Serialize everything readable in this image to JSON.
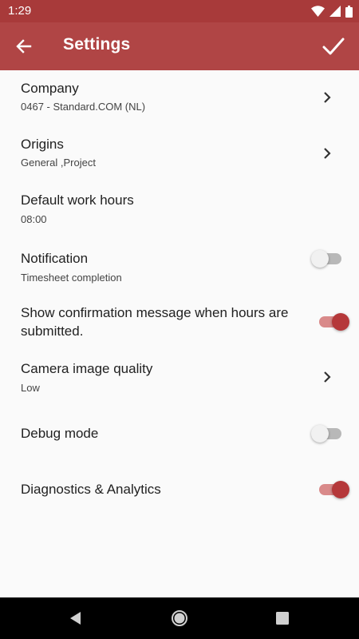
{
  "status_bar": {
    "time": "1:29",
    "icons": [
      "wifi-icon",
      "signal-icon",
      "battery-icon"
    ]
  },
  "app_bar": {
    "title": "Settings",
    "back_icon": "arrow-back-icon",
    "confirm_icon": "check-icon",
    "color": "#b04545"
  },
  "settings": {
    "company": {
      "title": "Company",
      "subtitle": "0467  -  Standard.COM (NL)"
    },
    "origins": {
      "title": "Origins",
      "subtitle": "General ,Project"
    },
    "default_work_hours": {
      "title": "Default work hours",
      "subtitle": "08:00"
    },
    "notification": {
      "title": "Notification",
      "subtitle": "Timesheet completion",
      "enabled": false
    },
    "show_confirmation": {
      "title_line1": "Show confirmation message when hours are",
      "title_line2": "submitted.",
      "enabled": true
    },
    "camera_quality": {
      "title": "Camera image quality",
      "subtitle": "Low"
    },
    "debug_mode": {
      "title": "Debug mode",
      "enabled": false
    },
    "diagnostics": {
      "title": "Diagnostics & Analytics",
      "enabled": true
    }
  },
  "nav_bar": {
    "buttons": [
      "back-triangle-icon",
      "home-circle-icon",
      "recents-square-icon"
    ]
  },
  "colors": {
    "accent": "#b5383a",
    "toggle_on_track": "#d98a8a",
    "toggle_off_track": "#b8b8b8"
  }
}
